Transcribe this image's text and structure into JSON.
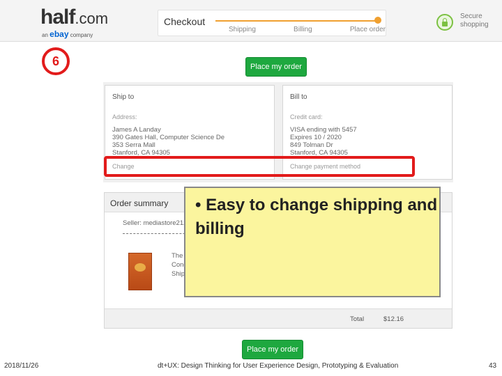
{
  "header": {
    "logo_main": "half",
    "logo_suffix": ".com",
    "logo_sub_prefix": "an",
    "logo_sub_brand": "ebay",
    "logo_sub_suffix": "company",
    "checkout_title": "Checkout",
    "steps": [
      "Shipping",
      "Billing",
      "Place order"
    ],
    "secure_line1": "Secure",
    "secure_line2": "shopping"
  },
  "step_number": "6",
  "place_order_label": "Place my order",
  "ship_to": {
    "title": "Ship to",
    "label": "Address:",
    "lines": [
      "James A Landay",
      "390 Gates Hall, Computer Science De",
      "353 Serra Mall",
      "Stanford, CA 94305"
    ],
    "link": "Change"
  },
  "bill_to": {
    "title": "Bill to",
    "label": "Credit card:",
    "lines": [
      "VISA ending with 5457",
      "Expires 10 / 2020",
      "849 Tolman Dr",
      "Stanford, CA 94305"
    ],
    "link": "Change payment method"
  },
  "summary": {
    "title": "Order summary",
    "seller": "Seller: mediastore2121",
    "item_lines": [
      "The",
      "Cond",
      "Shipp"
    ],
    "total_label": "Total",
    "total_value": "$12.16"
  },
  "callout": {
    "text": "• Easy to change shipping and billing"
  },
  "footer": {
    "date": "2018/11/26",
    "course": "dt+UX: Design Thinking for User Experience Design, Prototyping & Evaluation",
    "page": "43"
  },
  "colors": {
    "accent_red": "#e21b1b",
    "button_green": "#1ea83f",
    "progress_orange": "#f0a030",
    "callout_yellow": "#fbf59e"
  }
}
